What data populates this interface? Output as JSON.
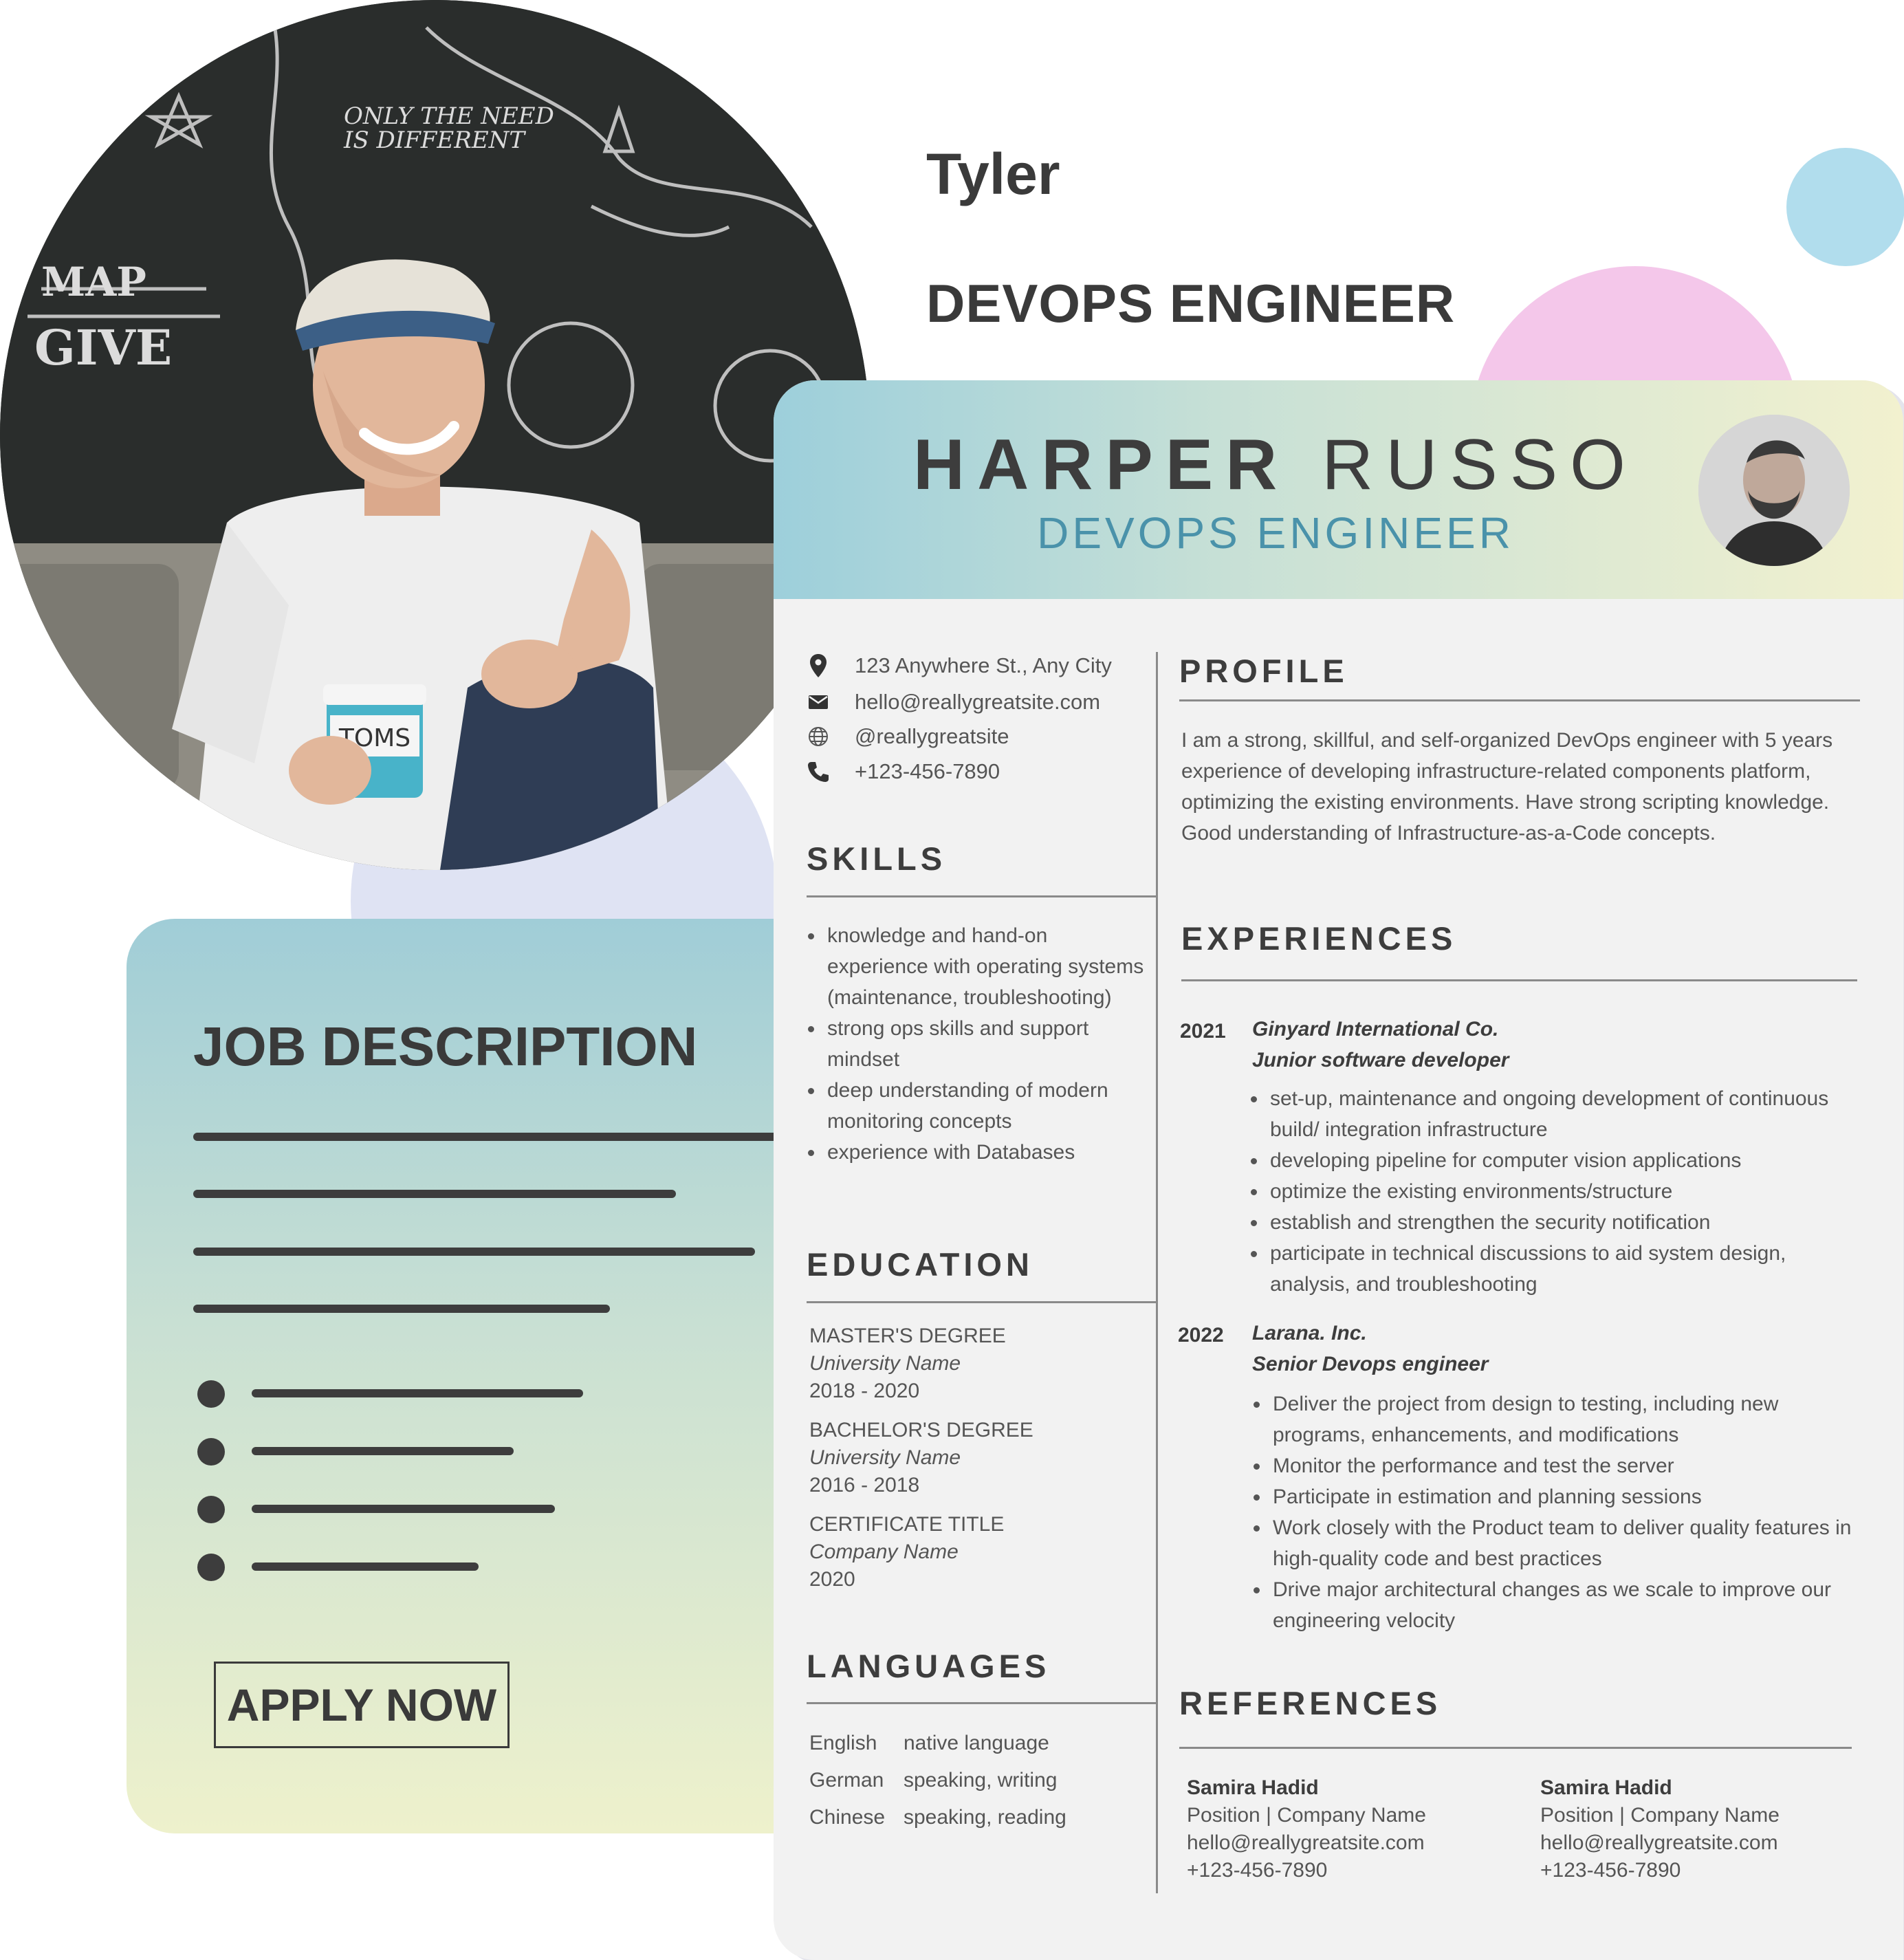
{
  "hero": {
    "name": "Tyler",
    "title": "DEVOPS ENGINEER"
  },
  "job_card": {
    "heading": "JOB DESCRIPTION",
    "apply_label": "APPLY NOW"
  },
  "resume": {
    "first_name": "HARPER",
    "last_name": "RUSSO",
    "title": "DEVOPS ENGINEER",
    "contact": {
      "address": "123 Anywhere St., Any City",
      "email": "hello@reallygreatsite.com",
      "website": "@reallygreatsite",
      "phone": "+123-456-7890"
    },
    "skills": {
      "title": "SKILLS",
      "items": [
        "knowledge and hand-on experience with  operating systems (maintenance, troubleshooting)",
        "strong ops skills and support mindset",
        "deep understanding of modern monitoring concepts",
        "experience with Databases"
      ]
    },
    "education": {
      "title": "EDUCATION",
      "items": [
        {
          "degree": "MASTER'S DEGREE",
          "school": "University Name",
          "years": "2018 - 2020"
        },
        {
          "degree": "BACHELOR'S DEGREE",
          "school": "University Name",
          "years": "2016 - 2018"
        },
        {
          "degree": "CERTIFICATE TITLE",
          "school": "Company Name",
          "years": "2020"
        }
      ]
    },
    "languages": {
      "title": "LANGUAGES",
      "items": [
        {
          "language": "English",
          "level": "native language"
        },
        {
          "language": "German",
          "level": "speaking, writing"
        },
        {
          "language": "Chinese",
          "level": "speaking, reading"
        }
      ]
    },
    "profile": {
      "title": "PROFILE",
      "text": "I am a strong, skillful, and self-organized DevOps engineer with 5 years experience of developing infrastructure-related components platform, optimizing the existing environments. Have strong  scripting knowledge. Good understanding of Infrastructure-as-a-Code concepts."
    },
    "experiences": {
      "title": "EXPERIENCES",
      "items": [
        {
          "year": "2021",
          "company": "Ginyard International Co.",
          "role": "Junior software developer",
          "bullets": [
            "set-up, maintenance and ongoing development of continuous build/ integration infrastructure",
            "developing pipeline for computer vision applications",
            "optimize the existing environments/structure",
            "establish and strengthen the security notification",
            "participate in technical discussions to aid system design, analysis, and troubleshooting"
          ]
        },
        {
          "year": "2022",
          "company": "Larana. Inc.",
          "role": "Senior Devops engineer",
          "bullets": [
            "Deliver the project from design to testing, including new programs, enhancements, and modifications",
            "Monitor the performance and test the server",
            "Participate in estimation and planning sessions",
            "Work closely with the Product team to deliver quality features in high-quality code and best practices",
            "Drive major architectural changes as we scale to improve our engineering velocity"
          ]
        }
      ]
    },
    "references": {
      "title": "REFERENCES",
      "items": [
        {
          "name": "Samira Hadid",
          "position": "Position | Company Name",
          "email": "hello@reallygreatsite.com",
          "phone": "+123-456-7890"
        },
        {
          "name": "Samira Hadid",
          "position": "Position | Company Name",
          "email": "hello@reallygreatsite.com",
          "phone": "+123-456-7890"
        }
      ]
    }
  },
  "icons": {
    "contact": [
      "map-pin-icon",
      "envelope-icon",
      "globe-icon",
      "phone-icon"
    ]
  },
  "colors": {
    "accent_blue": "#4a92aa",
    "deco_blue": "#b1dded",
    "deco_pink": "#f4c7ea",
    "deco_lavender": "#dfe3f3"
  }
}
